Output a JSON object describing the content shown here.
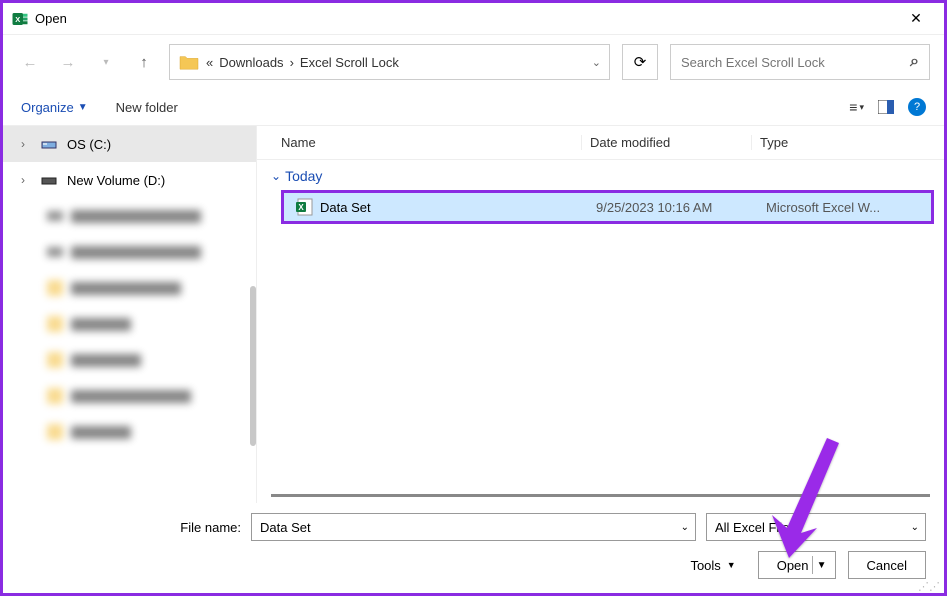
{
  "window": {
    "title": "Open"
  },
  "nav": {
    "breadcrumb_prefix": "«",
    "crumb1": "Downloads",
    "crumb2": "Excel Scroll Lock",
    "search_placeholder": "Search Excel Scroll Lock"
  },
  "toolbar": {
    "organize": "Organize",
    "newfolder": "New folder"
  },
  "sidebar": {
    "items": [
      {
        "label": "OS (C:)"
      },
      {
        "label": "New Volume (D:)"
      }
    ]
  },
  "columns": {
    "name": "Name",
    "date": "Date modified",
    "type": "Type"
  },
  "group": {
    "label": "Today"
  },
  "files": [
    {
      "name": "Data Set",
      "date": "9/25/2023 10:16 AM",
      "type": "Microsoft Excel W..."
    }
  ],
  "footer": {
    "filename_label": "File name:",
    "filename_value": "Data Set",
    "filter": "All Excel Files",
    "tools": "Tools",
    "open": "Open",
    "cancel": "Cancel"
  }
}
